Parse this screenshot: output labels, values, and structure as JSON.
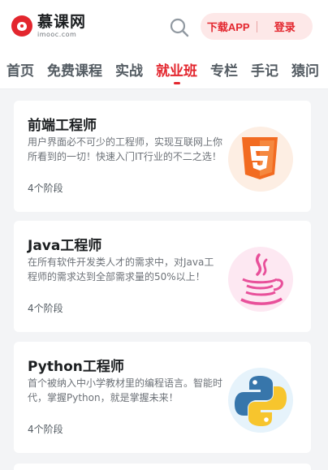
{
  "header": {
    "logo_name": "慕课网",
    "logo_domain": "imooc.com",
    "download_label": "下载APP",
    "login_label": "登录"
  },
  "nav": {
    "items": [
      "首页",
      "免费课程",
      "实战",
      "就业班",
      "专栏",
      "手记",
      "猿问"
    ],
    "active_index": 3
  },
  "courses": [
    {
      "title": "前端工程师",
      "description": "用户界面必不可少的工程师，实现互联网上你所看到的一切！快速入门IT行业的不二之选！",
      "stages": "4个阶段",
      "icon": "html5-icon"
    },
    {
      "title": "Java工程师",
      "description": "在所有软件开发类人才的需求中，对Java工程师的需求达到全部需求量的50%以上！",
      "stages": "4个阶段",
      "icon": "java-icon"
    },
    {
      "title": "Python工程师",
      "description": "首个被纳入中小学教材里的编程语言。智能时代，掌握Python，就是掌握未来！",
      "stages": "4个阶段",
      "icon": "python-icon"
    }
  ],
  "colors": {
    "brand_red": "#e3262e",
    "html5_orange": "#f26b21",
    "java_pink": "#e8509a",
    "python_blue": "#3776ab",
    "python_yellow": "#f7c52d"
  }
}
